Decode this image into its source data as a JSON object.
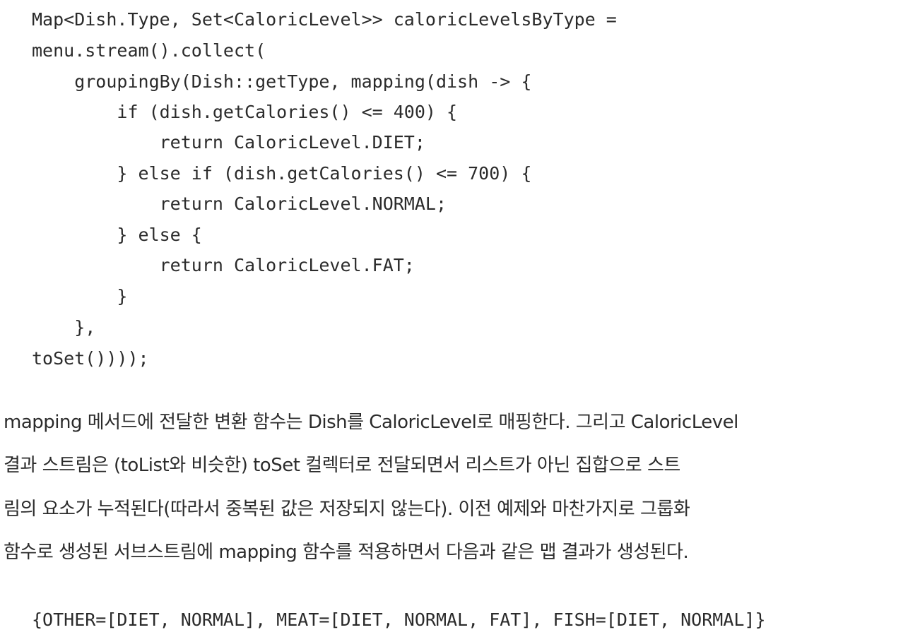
{
  "code": {
    "lines": [
      "Map<Dish.Type, Set<CaloricLevel>> caloricLevelsByType =",
      "menu.stream().collect(",
      "    groupingBy(Dish::getType, mapping(dish -> {",
      "        if (dish.getCalories() <= 400) {",
      "            return CaloricLevel.DIET;",
      "        } else if (dish.getCalories() <= 700) {",
      "            return CaloricLevel.NORMAL;",
      "        } else {",
      "            return CaloricLevel.FAT;",
      "        }",
      "    },",
      "toSet())));"
    ]
  },
  "prose": {
    "lines": [
      "mapping 메서드에 전달한 변환 함수는 Dish를 CaloricLevel로 매핑한다. 그리고 CaloricLevel",
      "결과 스트림은 (toList와 비슷한) toSet 컬렉터로 전달되면서 리스트가 아닌 집합으로 스트",
      "림의 요소가 누적된다(따라서 중복된 값은 저장되지 않는다). 이전 예제와 마찬가지로 그룹화",
      "함수로 생성된 서브스트림에 mapping 함수를 적용하면서 다음과 같은 맵 결과가 생성된다."
    ]
  },
  "result": {
    "text": "{OTHER=[DIET, NORMAL], MEAT=[DIET, NORMAL, FAT], FISH=[DIET, NORMAL]}"
  }
}
